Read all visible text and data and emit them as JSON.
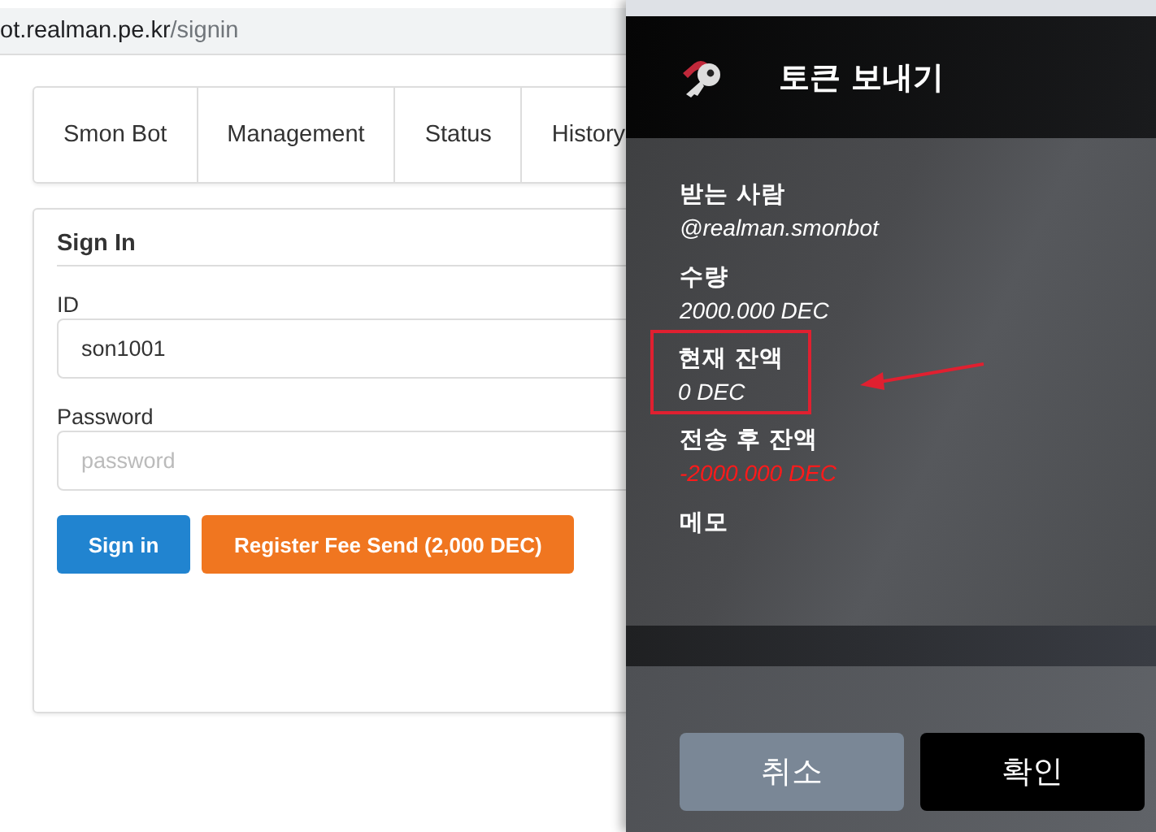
{
  "browser": {
    "url_host": "ot.realman.pe.kr",
    "url_path": "/signin"
  },
  "nav": {
    "items": [
      {
        "label": "Smon Bot"
      },
      {
        "label": "Management"
      },
      {
        "label": "Status"
      },
      {
        "label": "History"
      }
    ]
  },
  "signin": {
    "title": "Sign In",
    "fields": [
      {
        "label": "ID",
        "value": "son1001"
      },
      {
        "label": "Password",
        "placeholder": "password"
      }
    ],
    "buttons": [
      {
        "label": "Sign in",
        "kind": "primary"
      },
      {
        "label": "Register Fee Send (2,000 DEC)",
        "kind": "warning"
      }
    ]
  },
  "popup": {
    "title": "토큰 보내기",
    "fields": [
      {
        "label": "받는 사람",
        "value": "@realman.smonbot",
        "kind": "normal",
        "highlighted": false
      },
      {
        "label": "수량",
        "value": "2000.000 DEC",
        "kind": "normal",
        "highlighted": false
      },
      {
        "label": "현재 잔액",
        "value": "0 DEC",
        "kind": "normal",
        "highlighted": true
      },
      {
        "label": "전송 후 잔액",
        "value": "-2000.000 DEC",
        "kind": "negative",
        "highlighted": false
      },
      {
        "label": "메모",
        "highlighted": false
      }
    ],
    "buttons": [
      {
        "label": "취소",
        "kind": "cancel"
      },
      {
        "label": "확인",
        "kind": "confirm"
      }
    ]
  }
}
